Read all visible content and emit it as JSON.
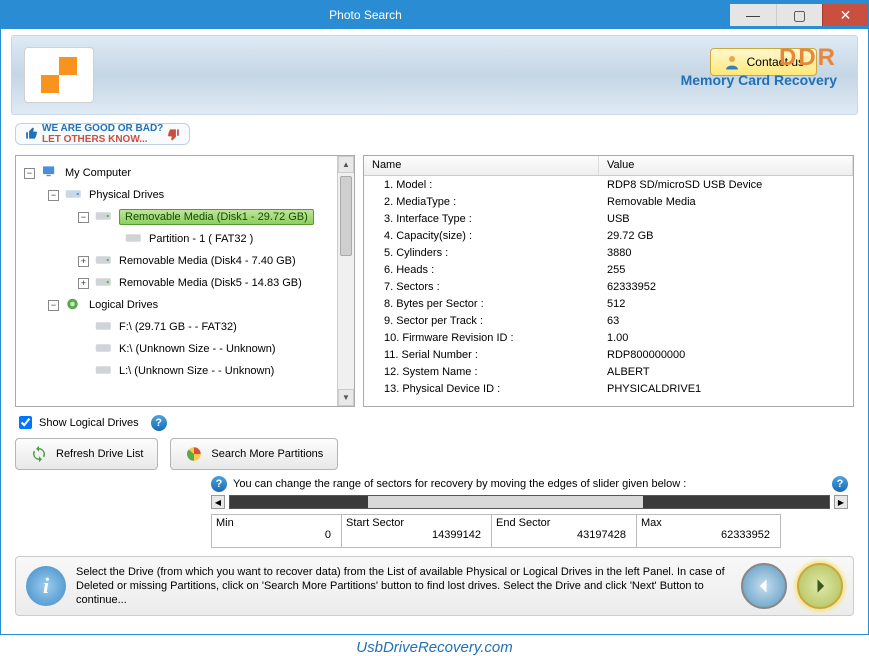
{
  "window": {
    "title": "Photo Search"
  },
  "banner": {
    "contact_label": "Contact us",
    "brand": "DDR",
    "brand_sub": "Memory Card Recovery"
  },
  "feedback": {
    "line1": "WE ARE GOOD OR BAD?",
    "line2": "LET OTHERS KNOW..."
  },
  "tree": {
    "root": "My Computer",
    "physical_label": "Physical Drives",
    "logical_label": "Logical Drives",
    "physical": [
      {
        "label": "Removable Media (Disk1 - 29.72 GB)",
        "selected": true,
        "expanded": true,
        "partition": "Partition - 1 ( FAT32 )"
      },
      {
        "label": "Removable Media (Disk4 - 7.40 GB)",
        "selected": false,
        "expanded": false
      },
      {
        "label": "Removable Media (Disk5 - 14.83 GB)",
        "selected": false,
        "expanded": false
      }
    ],
    "logical": [
      {
        "label": "F:\\ (29.71 GB  -  - FAT32)"
      },
      {
        "label": "K:\\ (Unknown Size  -  - Unknown)"
      },
      {
        "label": "L:\\ (Unknown Size  -  - Unknown)"
      }
    ]
  },
  "details": {
    "header_name": "Name",
    "header_value": "Value",
    "rows": [
      {
        "n": "1. Model :",
        "v": "RDP8 SD/microSD USB Device"
      },
      {
        "n": "2. MediaType :",
        "v": "Removable Media"
      },
      {
        "n": "3. Interface Type :",
        "v": "USB"
      },
      {
        "n": "4. Capacity(size) :",
        "v": "29.72 GB"
      },
      {
        "n": "5. Cylinders :",
        "v": "3880"
      },
      {
        "n": "6. Heads :",
        "v": "255"
      },
      {
        "n": "7. Sectors :",
        "v": "62333952"
      },
      {
        "n": "8. Bytes per Sector :",
        "v": "512"
      },
      {
        "n": "9. Sector per Track :",
        "v": "63"
      },
      {
        "n": "10. Firmware Revision ID :",
        "v": "1.00"
      },
      {
        "n": "11. Serial Number :",
        "v": "RDP800000000"
      },
      {
        "n": "12. System Name :",
        "v": "ALBERT"
      },
      {
        "n": "13. Physical Device ID :",
        "v": "PHYSICALDRIVE1"
      }
    ]
  },
  "controls": {
    "show_logical": "Show Logical Drives",
    "refresh": "Refresh Drive List",
    "search_more": "Search More Partitions"
  },
  "slider": {
    "hint": "You can change the range of sectors for recovery by moving the edges of slider given below :",
    "min_label": "Min",
    "min_value": "0",
    "start_label": "Start Sector",
    "start_value": "14399142",
    "end_label": "End Sector",
    "end_value": "43197428",
    "max_label": "Max",
    "max_value": "62333952"
  },
  "footer": {
    "text": "Select the Drive (from which you want to recover data) from the List of available Physical or Logical Drives in the left Panel. In case of Deleted or missing Partitions, click on 'Search More Partitions' button to find lost drives. Select the Drive and click 'Next' Button to continue..."
  },
  "watermark": "UsbDriveRecovery.com"
}
